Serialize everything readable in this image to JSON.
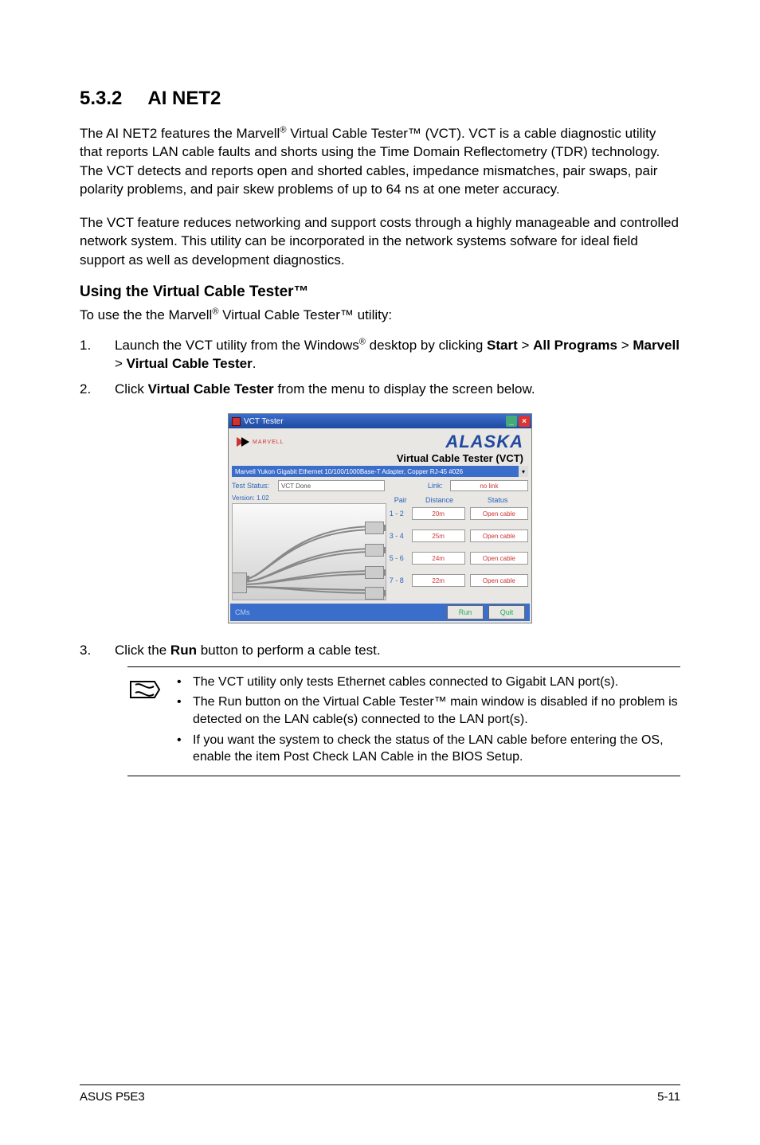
{
  "section_number": "5.3.2",
  "section_title": "AI NET2",
  "para1_pre": "The AI NET2 features the Marvell",
  "para1_post": " Virtual Cable Tester™ (VCT). VCT is a cable diagnostic utility that reports LAN cable faults and shorts using the Time Domain Reflectometry (TDR) technology. The VCT detects and reports open and shorted cables, impedance mismatches, pair swaps, pair polarity problems, and pair skew problems of up to 64 ns at one meter accuracy.",
  "para2": "The VCT feature reduces networking and support costs through a highly manageable and controlled network system. This utility can be incorporated in the network systems sofware for ideal field support as well as development diagnostics.",
  "sub_heading": "Using the Virtual Cable Tester™",
  "sub_line_pre": "To use the the Marvell",
  "sub_line_post": " Virtual Cable Tester™  utility:",
  "steps": {
    "s1_pre": "Launch the VCT utility from the Windows",
    "s1_mid": " desktop by clicking ",
    "s1_b1": "Start",
    "s1_gt1": " > ",
    "s1_b2": "All Programs",
    "s1_gt2": " > ",
    "s1_b3": "Marvell",
    "s1_gt3": " > ",
    "s1_b4": "Virtual Cable Tester",
    "s1_end": ".",
    "s2_a": "Click ",
    "s2_b": "Virtual Cable Tester",
    "s2_c": " from the menu to display the screen below.",
    "s3_a": "Click the ",
    "s3_b": "Run",
    "s3_c": " button to perform a cable test."
  },
  "app": {
    "title": "VCT Tester",
    "brand_small": "MARVELL",
    "brand_big": "ALASKA",
    "brand_sub": "Virtual Cable Tester (VCT)",
    "adapter_bar": "Marvell Yukon Gigabit Ethernet 10/100/1000Base-T Adapter, Copper RJ-45  #026",
    "test_status_label": "Test Status:",
    "test_status_value": "VCT Done",
    "version_label": "Version: 1.02",
    "link_label": "Link:",
    "link_value": "no link",
    "head_pair": "Pair",
    "head_distance": "Distance",
    "head_status": "Status",
    "rows": [
      {
        "pair": "1 - 2",
        "dist": "20m",
        "stat": "Open cable"
      },
      {
        "pair": "3 - 4",
        "dist": "25m",
        "stat": "Open cable"
      },
      {
        "pair": "5 - 6",
        "dist": "24m",
        "stat": "Open cable"
      },
      {
        "pair": "7 - 8",
        "dist": "22m",
        "stat": "Open cable"
      }
    ],
    "bottom_left": "CMs",
    "btn_run": "Run",
    "btn_quit": "Quit"
  },
  "notes": {
    "n1": "The VCT utility only tests Ethernet cables connected to Gigabit LAN port(s).",
    "n2": "The Run button on the Virtual Cable Tester™ main window is disabled if no problem is detected on the LAN cable(s) connected to the LAN port(s).",
    "n3": "If you want the system to check the status of the LAN cable before entering the OS, enable the item Post Check LAN Cable in the BIOS Setup."
  },
  "footer_left": "ASUS P5E3",
  "footer_right": "5-11",
  "reg": "®"
}
